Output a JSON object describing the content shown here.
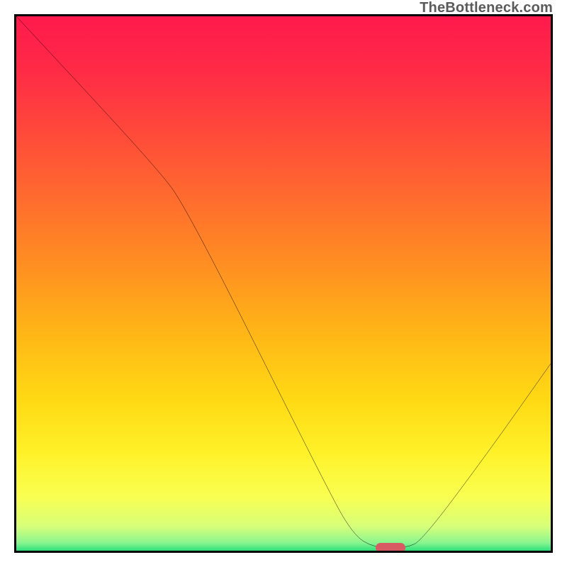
{
  "watermark": "TheBottleneck.com",
  "colors": {
    "frame_border": "#000000",
    "curve_stroke": "#000000",
    "marker_fill": "#d85a62",
    "gradient_stops": [
      {
        "offset": 0.0,
        "color": "#ff1a4d"
      },
      {
        "offset": 0.1,
        "color": "#ff2a46"
      },
      {
        "offset": 0.22,
        "color": "#ff4a3a"
      },
      {
        "offset": 0.35,
        "color": "#ff6e2d"
      },
      {
        "offset": 0.48,
        "color": "#ff9320"
      },
      {
        "offset": 0.6,
        "color": "#ffb816"
      },
      {
        "offset": 0.72,
        "color": "#ffda14"
      },
      {
        "offset": 0.82,
        "color": "#fff22a"
      },
      {
        "offset": 0.9,
        "color": "#f9ff52"
      },
      {
        "offset": 0.955,
        "color": "#d6ff7a"
      },
      {
        "offset": 0.985,
        "color": "#8af58f"
      },
      {
        "offset": 1.0,
        "color": "#2ee07b"
      }
    ]
  },
  "chart_data": {
    "type": "line",
    "title": "",
    "xlabel": "",
    "ylabel": "",
    "xlim": [
      0,
      100
    ],
    "ylim": [
      0,
      100
    ],
    "series": [
      {
        "name": "bottleneck-curve",
        "points": [
          {
            "x": 0,
            "y": 100
          },
          {
            "x": 26,
            "y": 72
          },
          {
            "x": 32,
            "y": 64
          },
          {
            "x": 58,
            "y": 12
          },
          {
            "x": 63,
            "y": 3
          },
          {
            "x": 67,
            "y": 0.5
          },
          {
            "x": 73,
            "y": 0.5
          },
          {
            "x": 76,
            "y": 2
          },
          {
            "x": 88,
            "y": 18
          },
          {
            "x": 100,
            "y": 35
          }
        ]
      }
    ],
    "marker": {
      "x": 70,
      "y": 0.5,
      "label": "optimal-point"
    }
  }
}
